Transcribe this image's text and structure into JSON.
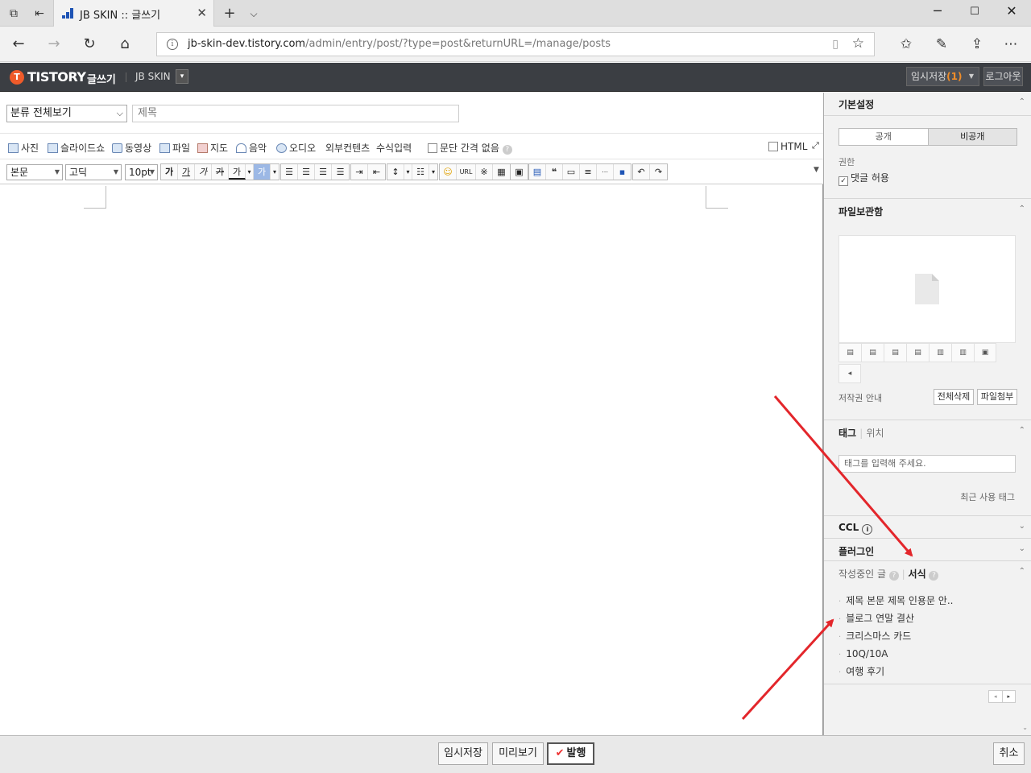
{
  "browser": {
    "tab_title": "JB SKIN :: 글쓰기",
    "url_host": "jb-skin-dev.tistory.com",
    "url_path": "/admin/entry/post/?type=post&returnURL=/manage/posts"
  },
  "header": {
    "logo": "TISTORY",
    "write_label": "글쓰기",
    "blog_name": "JB SKIN",
    "draft_label": "임시저장",
    "draft_count": "(1)",
    "logout_label": "로그아웃"
  },
  "editor": {
    "category": "분류 전체보기",
    "title_placeholder": "제목",
    "insert_items": [
      "사진",
      "슬라이드쇼",
      "동영상",
      "파일",
      "지도",
      "음악",
      "오디오",
      "외부컨텐츠",
      "수식입력"
    ],
    "paragraph_gap_label": "문단 간격 없음",
    "html_label": "HTML",
    "style_select": "본문",
    "font_select": "고딕",
    "size_select": "10pt",
    "text_buttons": [
      "가",
      "가",
      "가",
      "가",
      "가",
      "▾",
      "가",
      "▾"
    ],
    "url_label": "URL"
  },
  "sidebar": {
    "basic_settings": "기본설정",
    "public_label": "공개",
    "private_label": "비공개",
    "permission_label": "권한",
    "allow_comments": "댓글 허용",
    "file_storage": "파일보관함",
    "copyright_guide": "저작권 안내",
    "delete_all": "전체삭제",
    "attach_file": "파일첨부",
    "tag_label": "태그",
    "location_label": "위치",
    "tag_placeholder": "태그를 입력해 주세요.",
    "recent_tags": "최근 사용 태그",
    "ccl_label": "CCL",
    "plugin_label": "플러그인",
    "writing_label": "작성중인 글",
    "template_label": "서식",
    "templates": [
      "제목 본문 제목 인용문 안..",
      "블로그 연말 결산",
      "크리스마스 카드",
      "10Q/10A",
      "여행 후기"
    ]
  },
  "footer": {
    "save_draft": "임시저장",
    "preview": "미리보기",
    "publish": "발행",
    "cancel": "취소"
  },
  "colors": {
    "header_bg": "#3b3e43",
    "accent_orange": "#ef5b2a",
    "arrow_red": "#e3262b"
  }
}
